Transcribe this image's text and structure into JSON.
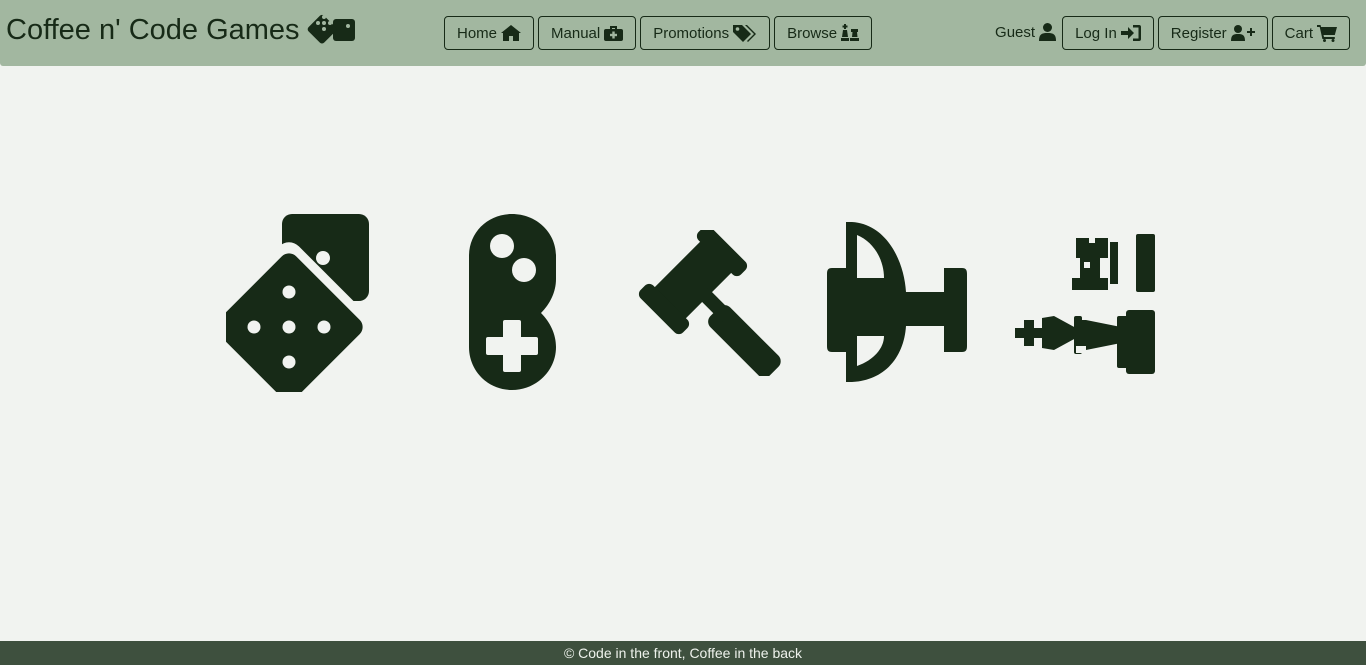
{
  "header": {
    "brand_title": "Coffee n' Code Games",
    "brand_icon": "dice-icon",
    "nav": [
      {
        "label": "Home",
        "icon": "home-icon"
      },
      {
        "label": "Manual",
        "icon": "first-aid-kit-icon"
      },
      {
        "label": "Promotions",
        "icon": "tags-icon"
      },
      {
        "label": "Browse",
        "icon": "chess-icon"
      }
    ],
    "guest_label": "Guest",
    "guest_icon": "user-icon",
    "login_label": "Log In",
    "register_label": "Register",
    "cart_label": "Cart"
  },
  "hero": {
    "icons": [
      "dice-icon",
      "gamepad-icon",
      "gavel-icon",
      "trophy-icon",
      "chess-pieces-icon"
    ]
  },
  "footer": {
    "text": "© Code in the front, Coffee in the back"
  },
  "colors": {
    "navbar": "#a2b7a0",
    "foreground": "#172a17",
    "page_background": "#f1f3f0",
    "footer": "#3e503e"
  }
}
